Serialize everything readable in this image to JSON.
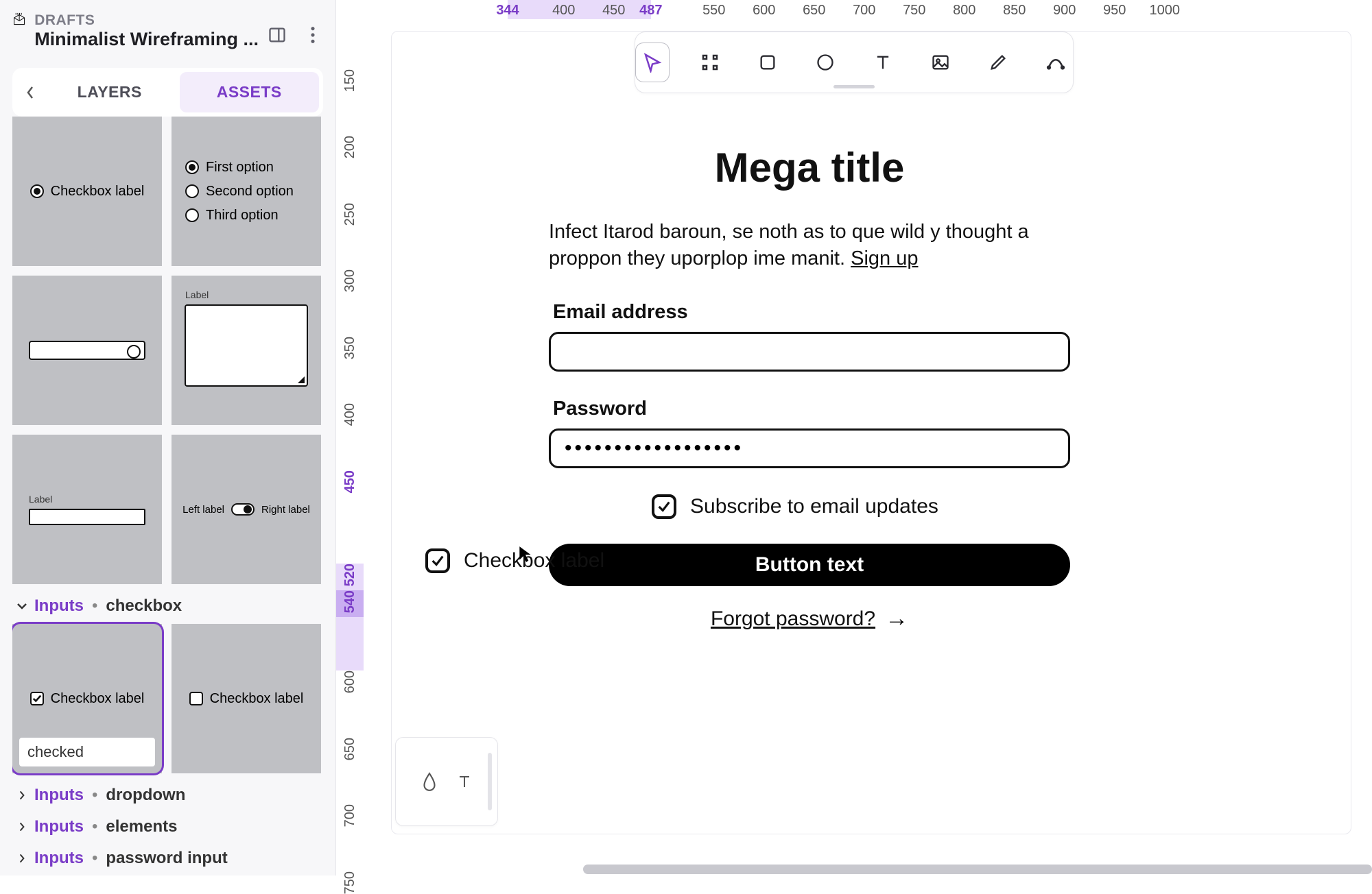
{
  "header": {
    "drafts_label": "DRAFTS",
    "file_name": "Minimalist Wireframing ..."
  },
  "tabs": {
    "layers": "LAYERS",
    "assets": "ASSETS",
    "active": "assets"
  },
  "ruler_x": {
    "accent_start": 344,
    "accent_end": 487,
    "ticks": [
      344,
      400,
      450,
      487,
      550,
      600,
      650,
      700,
      750,
      800,
      850,
      900,
      950,
      1000
    ]
  },
  "ruler_y": {
    "ticks": [
      150,
      200,
      250,
      300,
      350,
      400,
      450,
      520,
      540,
      600,
      650,
      700,
      750
    ],
    "accent": [
      450,
      520,
      540
    ],
    "highlight_small": [
      540,
      560
    ],
    "highlight_large": [
      520,
      600
    ]
  },
  "assets": {
    "radio_label": "Checkbox label",
    "radio_opts": [
      "First option",
      "Second option",
      "Third option"
    ],
    "textarea_label": "Label",
    "input_label": "Label",
    "toggle_left": "Left label",
    "toggle_right": "Right label",
    "check_label": "Checkbox label",
    "selected_caption": "checked"
  },
  "sections": {
    "open": {
      "a": "Inputs",
      "b": "checkbox"
    },
    "rest": [
      {
        "a": "Inputs",
        "b": "dropdown"
      },
      {
        "a": "Inputs",
        "b": "elements"
      },
      {
        "a": "Inputs",
        "b": "password input"
      }
    ]
  },
  "canvas": {
    "title": "Mega title",
    "blurb": "Infect Itarod baroun, se noth as to que wild y thought a proppon they uporplop ime manit. ",
    "blurb_link": "Sign up",
    "email_label": "Email address",
    "password_label": "Password",
    "password_value": "••••••••••••••••••",
    "subscribe_label": "Subscribe to email updates",
    "drag_label": "Checkbox label",
    "button_label": "Button text",
    "forgot_label": "Forgot password?"
  }
}
